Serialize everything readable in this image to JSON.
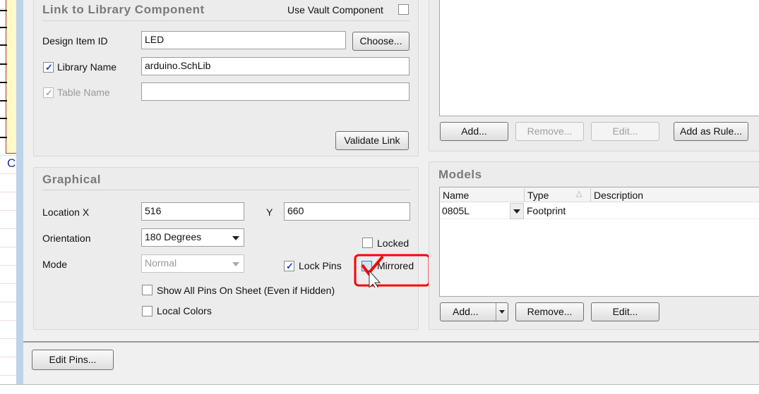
{
  "link": {
    "title": "Link to Library Component",
    "use_vault_label": "Use Vault Component",
    "use_vault_checked": false,
    "design_item_label": "Design Item ID",
    "design_item_value": "LED",
    "choose_label": "Choose...",
    "library_name_label": "Library Name",
    "library_name_checked": true,
    "library_name_value": "arduino.SchLib",
    "table_name_label": "Table Name",
    "table_name_checked": true,
    "table_name_value": "",
    "validate_label": "Validate Link"
  },
  "graphical": {
    "title": "Graphical",
    "location_x_label": "Location X",
    "location_x_value": "516",
    "location_y_label": "Y",
    "location_y_value": "660",
    "orientation_label": "Orientation",
    "orientation_value": "180 Degrees",
    "mode_label": "Mode",
    "mode_value": "Normal",
    "locked_label": "Locked",
    "locked_checked": false,
    "lock_pins_label": "Lock Pins",
    "lock_pins_checked": true,
    "mirrored_label": "Mirrored",
    "mirrored_checked": false,
    "show_all_pins_label": "Show All Pins On Sheet (Even if Hidden)",
    "local_colors_label": "Local Colors"
  },
  "parameters": {
    "add_label": "Add...",
    "remove_label": "Remove...",
    "edit_label": "Edit...",
    "add_rule_label": "Add as Rule..."
  },
  "models": {
    "title": "Models",
    "columns": [
      "Name",
      "Type",
      "Description"
    ],
    "rows": [
      {
        "name": "0805L",
        "type": "Footprint",
        "description": ""
      }
    ],
    "add_label": "Add...",
    "remove_label": "Remove...",
    "edit_label": "Edit..."
  },
  "footer": {
    "edit_pins_label": "Edit Pins..."
  },
  "annotation_color": "#ff0000",
  "schematic_partial_text": "C"
}
